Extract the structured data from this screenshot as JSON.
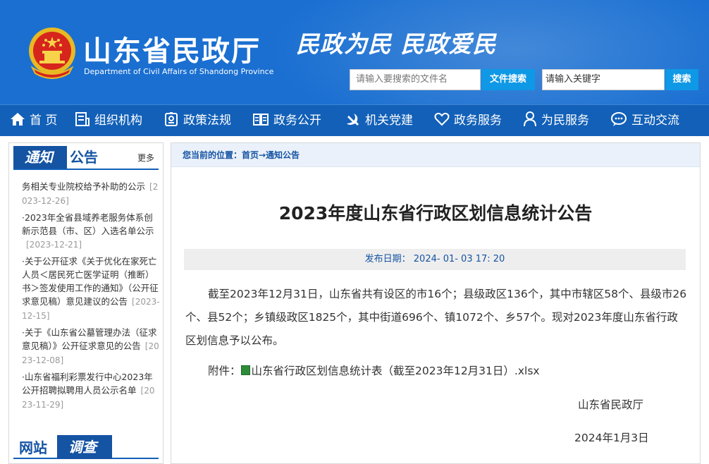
{
  "header": {
    "site_title": "山东省民政厅",
    "site_subtitle": "Department of Civil Affairs of Shandong Province",
    "slogan": "民政为民  民政爱民",
    "file_search": {
      "placeholder": "请输入要搜索的文件名",
      "button": "文件搜索"
    },
    "keyword_search": {
      "value": "请输入关键字",
      "button": "搜索"
    }
  },
  "nav": {
    "items": [
      {
        "label": "首 页",
        "icon": "home-icon"
      },
      {
        "label": "组织机构",
        "icon": "org-icon"
      },
      {
        "label": "政策法规",
        "icon": "policy-icon"
      },
      {
        "label": "政务公开",
        "icon": "book-icon"
      },
      {
        "label": "机关党建",
        "icon": "party-icon"
      },
      {
        "label": "政务服务",
        "icon": "heart-icon"
      },
      {
        "label": "为民服务",
        "icon": "person-icon"
      },
      {
        "label": "互动交流",
        "icon": "chat-icon"
      }
    ]
  },
  "sidebar": {
    "notice_tag_dark": "通知",
    "notice_tag_light": "公告",
    "more": "更多",
    "notices": [
      {
        "text": "务相关专业院校给予补助的公示",
        "date": "[2023-12-26]"
      },
      {
        "text": "·2023年全省县域养老服务体系创新示范县（市、区）入选名单公示",
        "date": "[2023-12-21]"
      },
      {
        "text": "·关于公开征求《关于优化在家死亡人员＜居民死亡医学证明（推断）书＞签发使用工作的通知》（公开征求意见稿）意见建议的公告",
        "date": "[2023-12-15]"
      },
      {
        "text": "·关于《山东省公墓管理办法（征求意见稿）》公开征求意见的公告",
        "date": "[2023-12-08]"
      },
      {
        "text": "·山东省福利彩票发行中心2023年公开招聘拟聘用人员公示名单",
        "date": "[2023-11-29]"
      }
    ],
    "survey_tag_light": "网站",
    "survey_tag_dark": "调查"
  },
  "main": {
    "breadcrumb": "您当前的位置：首页→通知公告",
    "title": "2023年度山东省行政区划信息统计公告",
    "publish": "发布日期： 2024- 01- 03 17: 20",
    "body": "截至2023年12月31日，山东省共有设区的市16个；县级政区136个，其中市辖区58个、县级市26个、县52个；乡镇级政区1825个，其中街道696个、镇1072个、乡57个。现对2023年度山东省行政区划信息予以公布。",
    "attachment_label": "附件：",
    "attachment_file": "山东省行政区划信息统计表（截至2023年12月31日）.xlsx",
    "signature": "山东省民政厅",
    "sign_date": "2024年1月3日"
  },
  "colors": {
    "header_bg": "#1a6fd1",
    "nav_bg": "#1260b8",
    "accent": "#1553a3",
    "button": "#0f98e6"
  }
}
